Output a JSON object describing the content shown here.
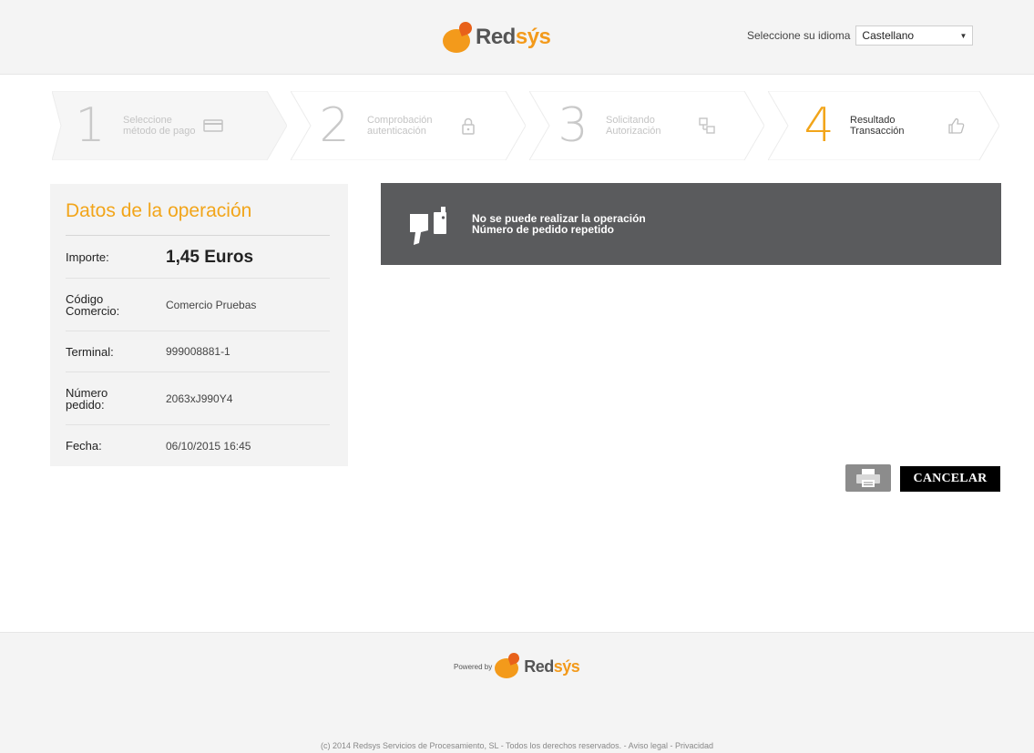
{
  "header": {
    "logo_text_main": "Red",
    "logo_text_accent": "sýs",
    "language_label": "Seleccione su idioma",
    "language_value": "Castellano"
  },
  "steps": [
    {
      "number": "1",
      "line1": "Seleccione",
      "line2": "método de pago",
      "icon": "credit-card-icon",
      "active": false
    },
    {
      "number": "2",
      "line1": "Comprobación",
      "line2": "autenticación",
      "icon": "lock-icon",
      "active": false
    },
    {
      "number": "3",
      "line1": "Solicitando",
      "line2": "Autorización",
      "icon": "network-icon",
      "active": false
    },
    {
      "number": "4",
      "line1": "Resultado",
      "line2": "Transacción",
      "icon": "thumbs-up-icon",
      "active": true
    }
  ],
  "operation": {
    "title": "Datos de la operación",
    "importe_label": "Importe:",
    "importe_value": "1,45  Euros",
    "codigo_label_1": "Código",
    "codigo_label_2": "Comercio:",
    "codigo_value": "Comercio Pruebas",
    "terminal_label": "Terminal:",
    "terminal_value": "999008881-1",
    "pedido_label_1": "Número",
    "pedido_label_2": "pedido:",
    "pedido_value": "2063xJ990Y4",
    "fecha_label": "Fecha:",
    "fecha_value": "06/10/2015   16:45"
  },
  "result": {
    "line1": "No se puede realizar la operación",
    "line2": "Número de pedido repetido",
    "icon": "thumbs-down-icon"
  },
  "actions": {
    "print_icon": "printer-icon",
    "cancel_label": "CANCELAR"
  },
  "footer": {
    "powered_label": "Powered by",
    "logo_text_main": "Red",
    "logo_text_accent": "sýs",
    "copyright": "(c) 2014 Redsys Servicios de Procesamiento, SL - Todos los derechos reservados.",
    "legal_link": "Aviso legal",
    "privacy_link": "Privacidad",
    "separator": " - "
  },
  "colors": {
    "accent": "#f2a51a",
    "result_bg": "#5a5b5d",
    "cancel_bg": "#000000"
  }
}
